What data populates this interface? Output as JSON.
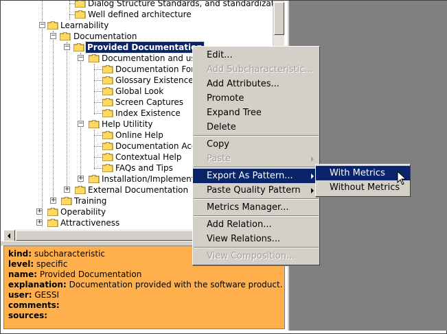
{
  "tree": {
    "nodes": [
      {
        "label": "Dialog Structure Standards, and standardizatic"
      },
      {
        "label": "Well defined architecture"
      },
      {
        "label": "Learnability"
      },
      {
        "label": "Documentation"
      },
      {
        "label": "Provided Documentation"
      },
      {
        "label": "Documentation and use"
      },
      {
        "label": "Documentation Forr"
      },
      {
        "label": "Glossary Existence"
      },
      {
        "label": "Global Look"
      },
      {
        "label": "Screen Captures"
      },
      {
        "label": "Index Existence"
      },
      {
        "label": "Help Utilitity"
      },
      {
        "label": "Online Help"
      },
      {
        "label": "Documentation Acce"
      },
      {
        "label": "Contextual Help"
      },
      {
        "label": "FAQs and Tips"
      },
      {
        "label": "Installation/Implementa"
      },
      {
        "label": "External Documentation"
      },
      {
        "label": "Training"
      },
      {
        "label": "Operability"
      },
      {
        "label": "Attractiveness"
      }
    ]
  },
  "info": {
    "kind_key": "kind:",
    "kind_value": "subcharacteristic",
    "level_key": "level:",
    "level_value": "specific",
    "name_key": "name:",
    "name_value": "Provided Documentation",
    "explanation_key": "explanation:",
    "explanation_value": "Documentation provided with the software product.",
    "user_key": "user:",
    "user_value": "GESSI",
    "comments_key": "comments:",
    "comments_value": "",
    "sources_key": "sources:",
    "sources_value": ""
  },
  "context_menu": {
    "edit": "Edit...",
    "add_subcharacteristic": "Add Subcharacteristic...",
    "add_attributes": "Add Attributes...",
    "promote": "Promote",
    "expand_tree": "Expand Tree",
    "delete": "Delete",
    "copy": "Copy",
    "paste": "Paste",
    "export_as_pattern": "Export As Pattern...",
    "paste_quality_pattern": "Paste Quality Pattern",
    "metrics_manager": "Metrics Manager...",
    "add_relation": "Add Relation...",
    "view_relations": "View Relations...",
    "view_composition": "View Composition..."
  },
  "submenu": {
    "with_metrics": "With Metrics",
    "without_metrics": "Without Metrics"
  },
  "colors": {
    "selection": "#0a246a",
    "info_background": "#ffb04d",
    "menu_background": "#d4d0c8",
    "right_panel": "#808080"
  },
  "icons": {
    "folder": "folder-icon",
    "expand": "expand-plus-icon",
    "collapse": "collapse-minus-icon",
    "submenu_arrow": "chevron-right-icon",
    "cursor": "mouse-pointer-icon"
  }
}
